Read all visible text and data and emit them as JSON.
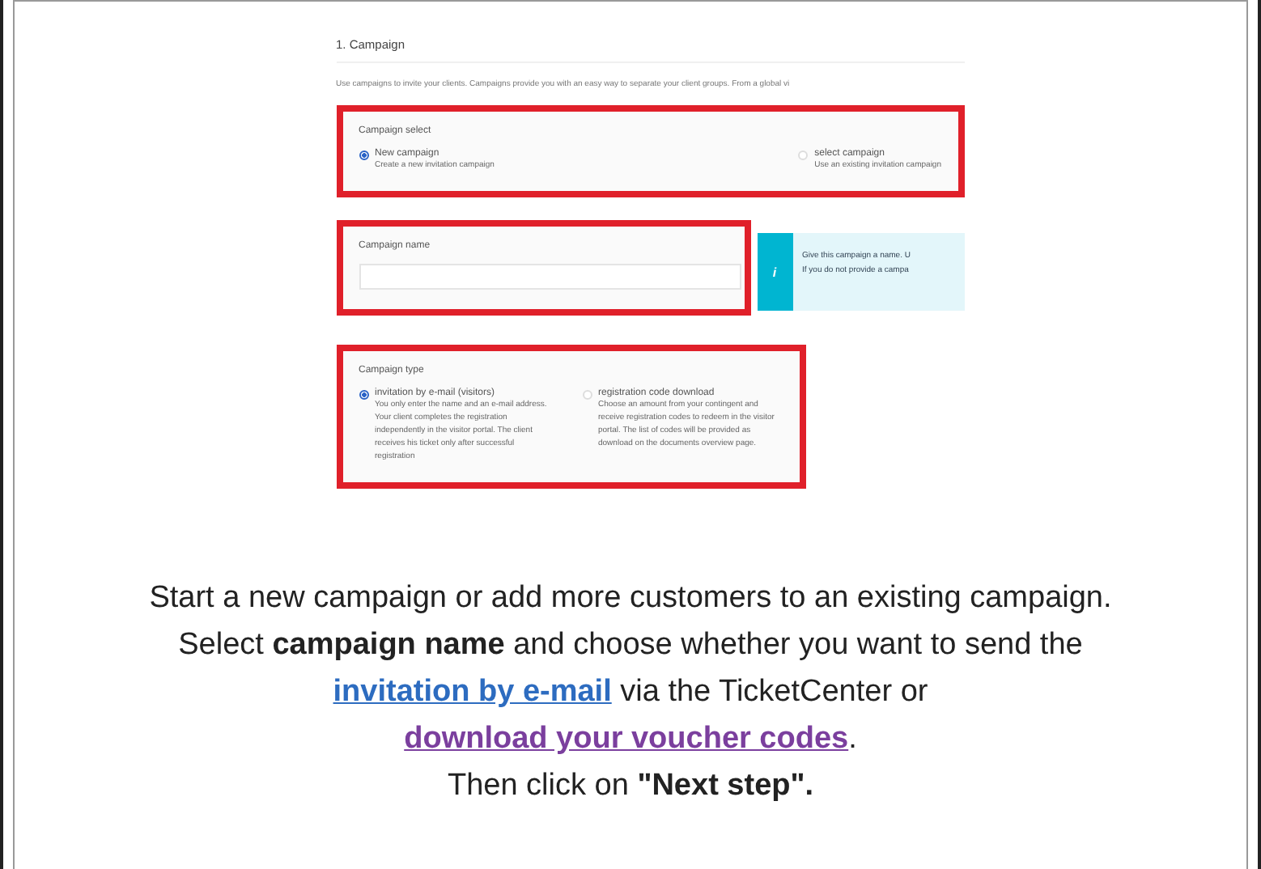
{
  "screenshot": {
    "heading": "1. Campaign",
    "intro": "Use campaigns to invite your clients. Campaigns provide you with an easy way to separate your client groups. From a global vi",
    "campaign_select": {
      "label": "Campaign select",
      "highlighted": true,
      "options": [
        {
          "title": "New campaign",
          "description": "Create a new invitation campaign",
          "selected": true
        },
        {
          "title": "select campaign",
          "description": "Use an existing invitation campaign",
          "selected": false
        }
      ]
    },
    "campaign_name": {
      "label": "Campaign name",
      "highlighted": true
    },
    "info": {
      "icon": "i",
      "lines": [
        "Give this campaign a name. U",
        "If you do not provide a campa"
      ]
    },
    "campaign_type": {
      "label": "Campaign type",
      "highlighted": true,
      "options": [
        {
          "title": "invitation by e-mail (visitors)",
          "description": "You only enter the name and an e-mail address. Your client completes the registration independently in the visitor portal. The client receives his ticket only after successful registration",
          "selected": true
        },
        {
          "title": "registration code download",
          "description": "Choose an amount from your contingent and receive registration codes to redeem in the visitor portal. The list of codes will be provided as download on the documents overview page.",
          "selected": false
        }
      ]
    }
  },
  "caption": {
    "paragraphs": [
      [
        {
          "kind": "text",
          "text": "Start a new campaign or add more customers to an existing campaign. Select **campaign name** and choose whether you want to send the "
        },
        {
          "kind": "link",
          "text": "invitation by e-mail",
          "visited": false
        },
        {
          "kind": "text",
          "text": " via the TicketCenter or "
        },
        {
          "kind": "link",
          "text": "download your voucher codes",
          "visited": true
        },
        {
          "kind": "text",
          "text": "."
        }
      ],
      [
        {
          "kind": "text",
          "text": "Then click on **\"Next step\".**"
        }
      ]
    ]
  }
}
